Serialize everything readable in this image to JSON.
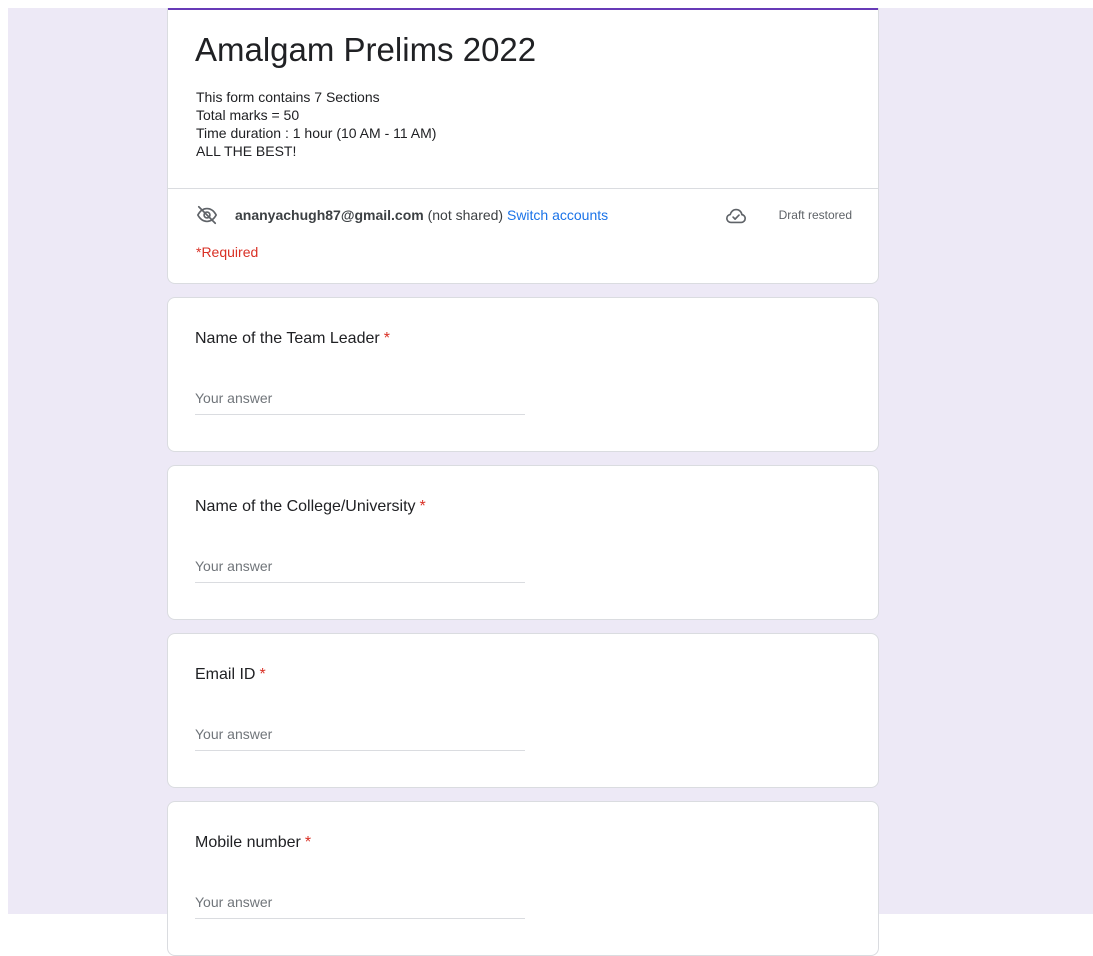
{
  "form": {
    "title": "Amalgam Prelims 2022",
    "description": [
      "This form contains 7 Sections",
      "Total marks = 50",
      "Time duration : 1 hour (10 AM - 11 AM)",
      "ALL THE BEST!"
    ],
    "account": {
      "icon": "eye-off-icon",
      "email": "ananyachugh87@gmail.com",
      "shared_note": "(not shared)",
      "switch_label": "Switch accounts"
    },
    "draft": {
      "icon": "cloud-check-icon",
      "status": "Draft restored"
    },
    "required_note": "*Required"
  },
  "questions": [
    {
      "label": "Name of the Team Leader",
      "required_mark": "*",
      "placeholder": "Your answer"
    },
    {
      "label": "Name of the College/University",
      "required_mark": "*",
      "placeholder": "Your answer"
    },
    {
      "label": "Email ID",
      "required_mark": "*",
      "placeholder": "Your answer"
    },
    {
      "label": "Mobile number",
      "required_mark": "*",
      "placeholder": "Your answer"
    }
  ],
  "colors": {
    "accent": "#673ab7",
    "background": "#ede9f6",
    "link": "#1a73e8",
    "required": "#d93025"
  }
}
